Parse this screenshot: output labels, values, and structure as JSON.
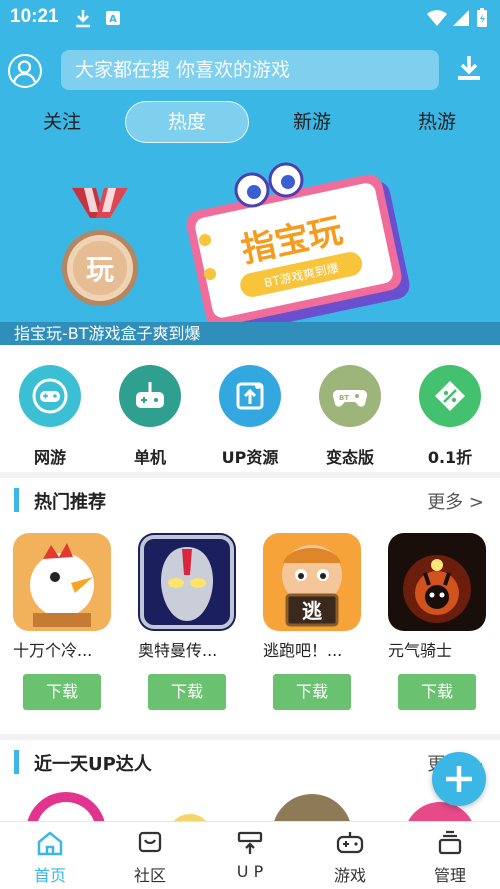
{
  "statusbar": {
    "time": "10:21"
  },
  "header": {
    "search_placeholder": "大家都在搜  你喜欢的游戏",
    "tabs": [
      "关注",
      "热度",
      "新游",
      "热游"
    ],
    "active_tab": "热度"
  },
  "banner": {
    "caption": "指宝玩-BT游戏盒子爽到爆",
    "medal_text": "玩",
    "sign_title": "指宝玩",
    "sign_subtitle": "BT游戏爽到爆"
  },
  "categories": [
    {
      "label": "网游",
      "color": "#3bbfd4"
    },
    {
      "label": "单机",
      "color": "#2f9f90"
    },
    {
      "label": "UP资源",
      "color": "#33a7e0"
    },
    {
      "label": "变态版",
      "color": "#9db47a"
    },
    {
      "label": "0.1折",
      "color": "#43c16e"
    }
  ],
  "hot": {
    "title": "热门推荐",
    "more": "更多 >",
    "games": [
      {
        "name": "十万个冷...",
        "download": "下载"
      },
      {
        "name": "奥特曼传...",
        "download": "下载"
      },
      {
        "name": "逃跑吧！...",
        "download": "下载",
        "sign": "逃"
      },
      {
        "name": "元气骑士",
        "download": "下载"
      }
    ]
  },
  "up": {
    "title": "近一天UP达人",
    "more": "更多 >"
  },
  "nav": [
    {
      "label": "首页",
      "active": true
    },
    {
      "label": "社区",
      "active": false
    },
    {
      "label": "U P",
      "active": false
    },
    {
      "label": "游戏",
      "active": false
    },
    {
      "label": "管理",
      "active": false
    }
  ],
  "colors": {
    "primary": "#3bb7e6",
    "download_green": "#6ac271"
  }
}
